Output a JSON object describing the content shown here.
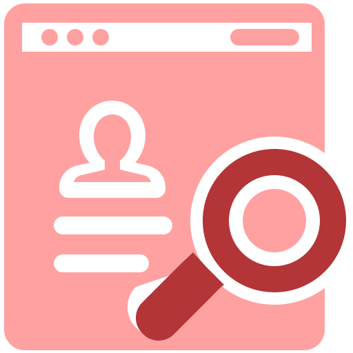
{
  "icon": {
    "semantic": "profile-search-icon",
    "parts": [
      "browser-window",
      "window-control-dots",
      "address-bar",
      "user-avatar",
      "text-lines",
      "magnifying-glass"
    ]
  },
  "colors": {
    "window_fill": "#ffa1a1",
    "detail_white": "#ffffff",
    "magnifier_fill": "#b33538",
    "background": "#ffffff"
  }
}
